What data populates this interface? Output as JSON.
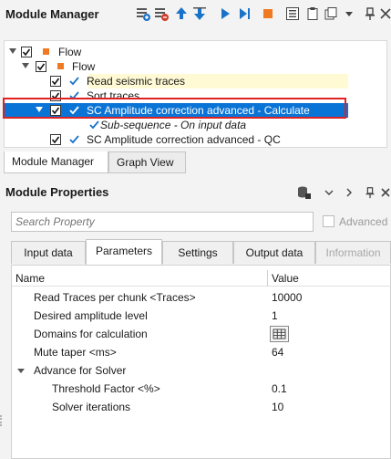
{
  "module_manager": {
    "title": "Module Manager",
    "toolbar_icons": [
      "add-module-icon",
      "remove-module-icon",
      "move-up-icon",
      "move-down-icon",
      "run-icon",
      "run-next-icon",
      "stop-icon",
      "list-icon",
      "clipboard-icon",
      "copy-icon",
      "dropdown-icon",
      "pin-icon",
      "close-icon"
    ],
    "tree": [
      {
        "label": "Flow",
        "level": 0
      },
      {
        "label": "Flow",
        "level": 1
      },
      {
        "label": "Read seismic traces",
        "level": 2
      },
      {
        "label": "Sort traces",
        "level": 2
      },
      {
        "label": "SC Amplitude correction advanced - Calculate",
        "level": 2,
        "selected": true
      },
      {
        "label": "Sub-sequence - On input data",
        "level": 3
      },
      {
        "label": "SC Amplitude correction advanced - QC",
        "level": 2
      }
    ],
    "tabs": [
      "Module Manager",
      "Graph View"
    ]
  },
  "module_properties": {
    "title": "Module Properties",
    "search_placeholder": "Search Property",
    "advanced_label": "Advanced",
    "tabs": [
      "Input data",
      "Parameters",
      "Settings",
      "Output data",
      "Information"
    ],
    "columns": {
      "name": "Name",
      "value": "Value"
    },
    "rows": [
      {
        "name": "Read Traces per chunk <Traces>",
        "value": "10000"
      },
      {
        "name": "Desired amplitude level",
        "value": "1"
      },
      {
        "name": "Domains for calculation",
        "value": ""
      },
      {
        "name": "Mute taper <ms>",
        "value": "64"
      },
      {
        "name": "Advance for Solver",
        "value": ""
      },
      {
        "name": "Threshold Factor <%>",
        "value": "0.1"
      },
      {
        "name": "Solver iterations",
        "value": "10"
      }
    ]
  },
  "colors": {
    "accent": "#0a74d6",
    "highlight": "#fffad4",
    "selection_box": "#e02121",
    "orange": "#f07a21"
  }
}
